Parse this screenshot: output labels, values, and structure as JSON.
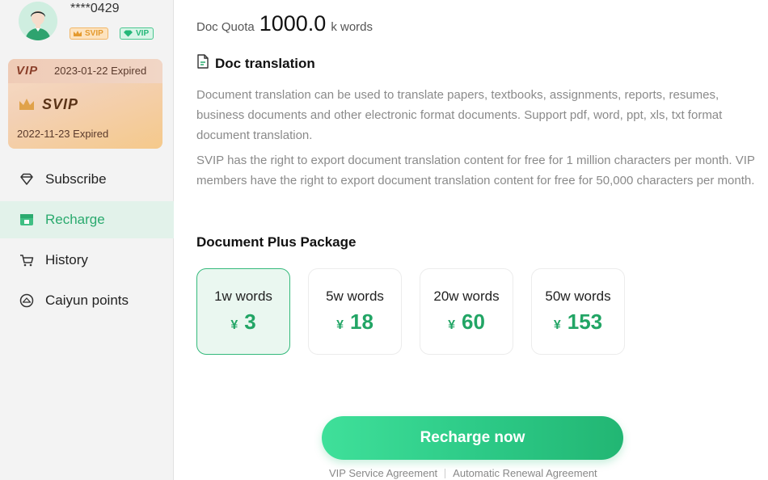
{
  "user": {
    "name": "****0429",
    "badges": {
      "svip": "SVIP",
      "vip": "VIP"
    }
  },
  "membership": {
    "vip_label": "VIP",
    "vip_expiry": "2023-01-22 Expired",
    "svip_label": "SVIP",
    "svip_expiry": "2022-11-23 Expired"
  },
  "nav": {
    "items": [
      {
        "label": "Subscribe",
        "icon": "diamond-icon"
      },
      {
        "label": "Recharge",
        "icon": "store-icon",
        "active": true
      },
      {
        "label": "History",
        "icon": "cart-icon"
      },
      {
        "label": "Caiyun points",
        "icon": "points-icon"
      }
    ]
  },
  "quota": {
    "label": "Doc Quota",
    "value": "1000.0",
    "unit": "k words"
  },
  "section": {
    "title": "Doc translation",
    "desc1": "Document translation can be used to translate papers, textbooks, assignments, reports, resumes, business documents and other electronic format documents. Support pdf, word, ppt, xls, txt format document translation.",
    "desc2": "SVIP has the right to export document translation content for free for 1 million characters per month. VIP members have the right to export document translation content for free for 50,000 characters per month."
  },
  "packages": {
    "title": "Document Plus Package",
    "currency": "¥",
    "items": [
      {
        "words": "1w words",
        "price": "3",
        "selected": true
      },
      {
        "words": "5w words",
        "price": "18"
      },
      {
        "words": "20w words",
        "price": "60"
      },
      {
        "words": "50w words",
        "price": "153"
      }
    ]
  },
  "actions": {
    "recharge_label": "Recharge now",
    "vip_agreement": "VIP Service Agreement",
    "renewal_agreement": "Automatic Renewal Agreement"
  },
  "colors": {
    "accent": "#2aaa6e",
    "price": "#22a565",
    "sidebar_bg": "#f3f3f3"
  }
}
